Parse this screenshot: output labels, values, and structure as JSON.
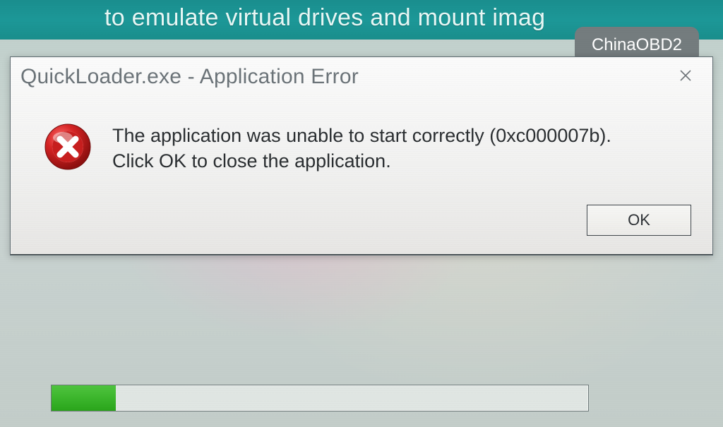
{
  "background": {
    "header_text": "to emulate virtual drives and mount imag"
  },
  "watermark": {
    "label": "ChinaOBD2"
  },
  "dialog": {
    "title": "QuickLoader.exe - Application Error",
    "message_line1": "The application was unable to start correctly (0xc000007b).",
    "message_line2": "Click OK to close the application.",
    "ok_label": "OK"
  },
  "progress": {
    "percent": 12
  }
}
